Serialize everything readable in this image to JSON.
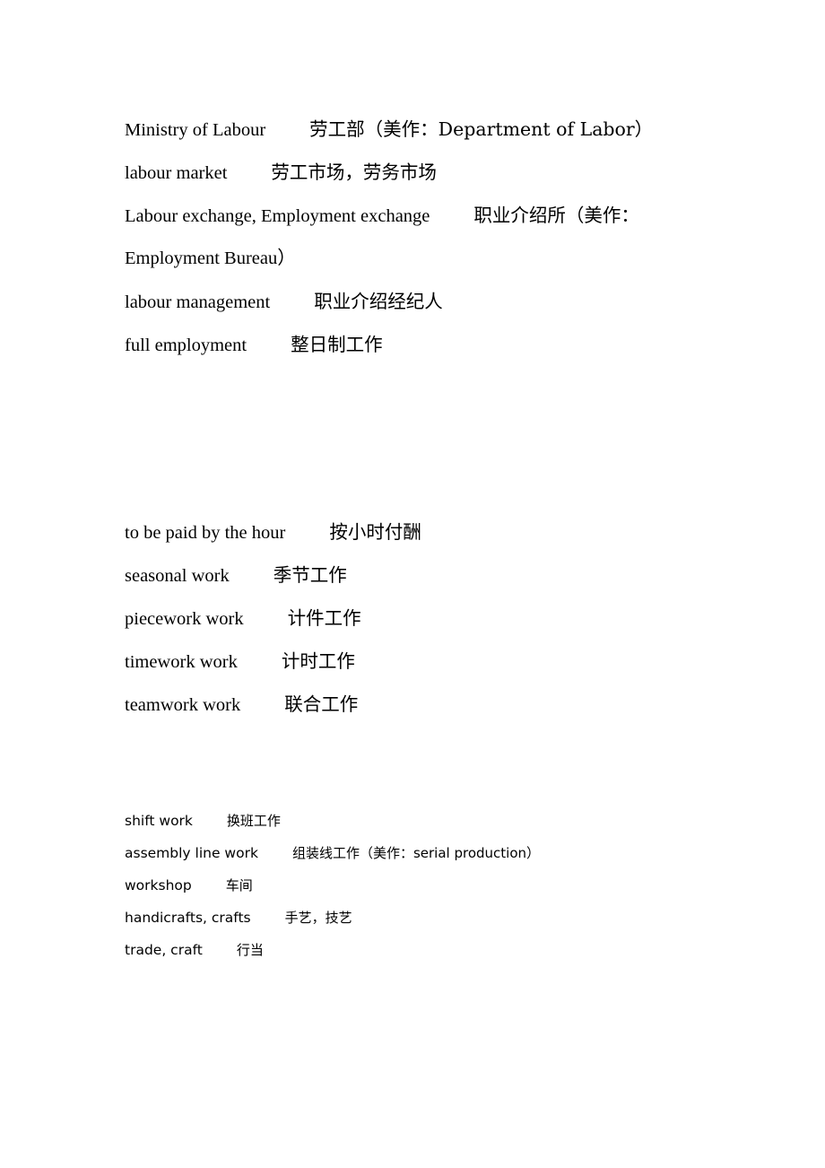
{
  "document": {
    "section1": [
      {
        "term": "Ministry of Labour",
        "translation": "劳工部（美作：Department of Labor）"
      },
      {
        "term": "labour market",
        "translation": "劳工市场，劳务市场"
      },
      {
        "term": "Labour exchange, Employment exchange",
        "translation": "职业介绍所（美作："
      },
      {
        "term": "Employment Bureau）",
        "translation": ""
      },
      {
        "term": "labour management",
        "translation": "职业介绍经纪人"
      },
      {
        "term": "full employment",
        "translation": "整日制工作"
      }
    ],
    "section2": [
      {
        "term": "to be paid by the hour",
        "translation": "按小时付酬"
      },
      {
        "term": "seasonal work",
        "translation": "季节工作"
      },
      {
        "term": "piecework work",
        "translation": "计件工作"
      },
      {
        "term": "timework work",
        "translation": "计时工作"
      },
      {
        "term": "teamwork work",
        "translation": "联合工作"
      }
    ],
    "section3": [
      {
        "term": "shift work",
        "translation": "换班工作"
      },
      {
        "term": "assembly line work",
        "translation": "组装线工作（美作：serial production）"
      },
      {
        "term": "workshop",
        "translation": "车间"
      },
      {
        "term": "handicrafts, crafts",
        "translation": "手艺，技艺"
      },
      {
        "term": "trade, craft",
        "translation": "行当"
      }
    ]
  }
}
